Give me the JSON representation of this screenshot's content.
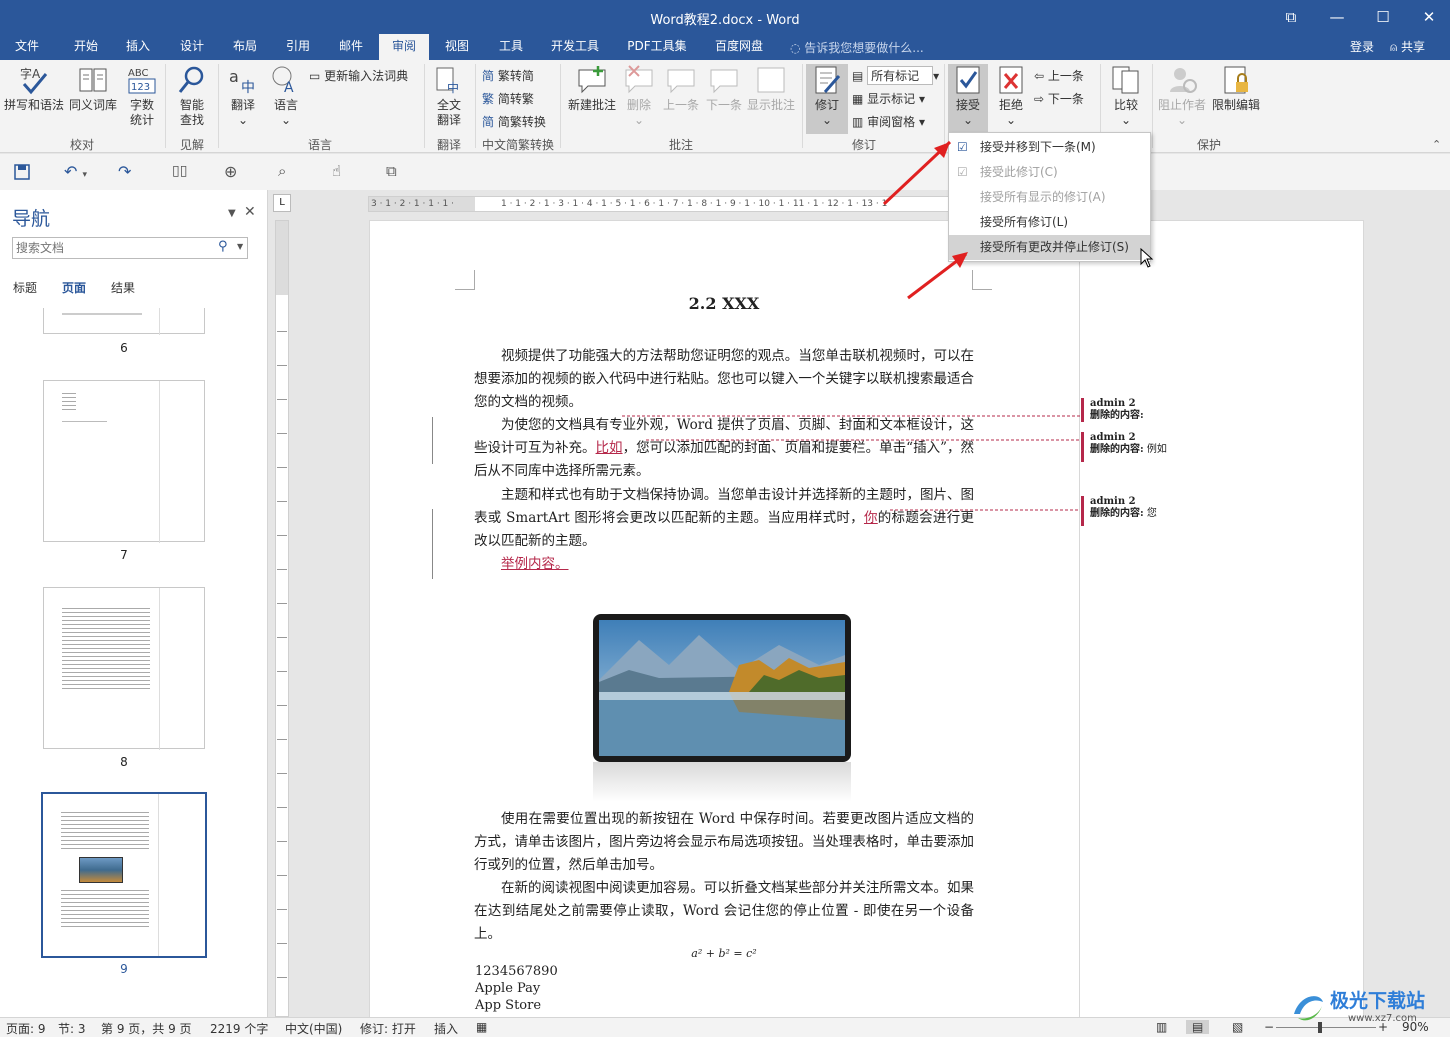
{
  "window": {
    "title": "Word教程2.docx - Word",
    "restore": "⧉",
    "minimize": "—",
    "maximize": "☐",
    "close": "✕"
  },
  "tabs": [
    {
      "label": "文件"
    },
    {
      "label": "开始"
    },
    {
      "label": "插入"
    },
    {
      "label": "设计"
    },
    {
      "label": "布局"
    },
    {
      "label": "引用"
    },
    {
      "label": "邮件"
    },
    {
      "label": "审阅"
    },
    {
      "label": "视图"
    },
    {
      "label": "工具"
    },
    {
      "label": "开发工具"
    },
    {
      "label": "PDF工具集"
    },
    {
      "label": "百度网盘"
    }
  ],
  "tellme": "告诉我您想要做什么...",
  "account": {
    "login": "登录",
    "share": "共享"
  },
  "ribbon": {
    "spell": "拼写和语法",
    "thesaurus": "同义词库",
    "wordcount1": "字数",
    "wordcount2": "统计",
    "smart1": "智能",
    "smart2": "查找",
    "translate": "翻译",
    "language": "语言",
    "ime_dict": "更新输入法词典",
    "fulltrans1": "全文",
    "fulltrans2": "翻译",
    "t2s": "繁转简",
    "s2t": "简转繁",
    "convert": "简繁转换",
    "new_comment": "新建批注",
    "delete": "删除",
    "prev": "上一条",
    "next": "下一条",
    "show_comments": "显示批注",
    "track": "修订",
    "all_markup": "所有标记",
    "show_markup": "显示标记",
    "review_pane": "审阅窗格",
    "accept": "接受",
    "reject": "拒绝",
    "prev_change": "上一条",
    "next_change": "下一条",
    "compare": "比较",
    "block_authors": "阻止作者",
    "restrict": "限制编辑",
    "groups": {
      "proofing": "校对",
      "insights": "见解",
      "language": "语言",
      "translation": "翻译",
      "chinese": "中文简繁转换",
      "comments": "批注",
      "tracking": "修订",
      "protect": "保护"
    }
  },
  "menu": [
    {
      "label": "接受并移到下一条(M)",
      "enabled": true
    },
    {
      "label": "接受此修订(C)",
      "enabled": false
    },
    {
      "label": "接受所有显示的修订(A)",
      "enabled": false
    },
    {
      "label": "接受所有修订(L)",
      "enabled": true
    },
    {
      "label": "接受所有更改并停止修订(S)",
      "enabled": true,
      "highlighted": true
    }
  ],
  "nav": {
    "title": "导航",
    "search_placeholder": "搜索文档",
    "tabs": [
      "标题",
      "页面",
      "结果"
    ],
    "active_tab": "页面",
    "pages": [
      "6",
      "7",
      "8",
      "9"
    ],
    "current_page": "9"
  },
  "document": {
    "heading": "2.2 XXX",
    "para1": "视频提供了功能强大的方法帮助您证明您的观点。当您单击联机视频时，可以在想要添加的视频的嵌入代码中进行粘贴。您也可以键入一个关键字以联机搜索最适合您的文档的视频。",
    "para2a": "为使您的文档具有专业外观，Word 提供了页眉、页脚、封面和文本框设计，这些设计可互为补充。",
    "para2_ins": "比如",
    "para2b": "，您可以添加匹配的封面、页眉和提要栏。单击“插入”，然后从不同库中选择所需元素。",
    "para3a": "主题和样式也有助于文档保持协调。当您单击设计并选择新的主题时，图片、图表或 SmartArt 图形将会更改以匹配新的主题。当应用样式时，",
    "para3_ins": "你",
    "para3b": "的标题会进行更改以匹配新的主题。",
    "para4_ins": "举例内容。",
    "para5": "使用在需要位置出现的新按钮在 Word 中保存时间。若要更改图片适应文档的方式，请单击该图片，图片旁边将会显示布局选项按钮。当处理表格时，单击要添加行或列的位置，然后单击加号。",
    "para6": "在新的阅读视图中阅读更加容易。可以折叠文档某些部分并关注所需文本。如果在达到结尾处之前需要停止读取，Word 会记住您的停止位置 - 即使在另一个设备上。",
    "formula": "a² + b² = c²",
    "lines": [
      "1234567890",
      "Apple Pay",
      "App Store"
    ]
  },
  "balloons": [
    {
      "author": "admin 2",
      "label": "删除的内容:",
      "text": ""
    },
    {
      "author": "admin 2",
      "label": "删除的内容:",
      "text": "例如"
    },
    {
      "author": "admin 2",
      "label": "删除的内容:",
      "text": "您"
    }
  ],
  "status": {
    "page": "页面: 9",
    "section": "节: 3",
    "pages": "第 9 页，共 9 页",
    "words": "2219 个字",
    "lang": "中文(中国)",
    "track": "修订: 打开",
    "insert": "插入",
    "zoom": "90%"
  },
  "watermark": "极光下载站",
  "watermark_url": "www.xz7.com",
  "colors": {
    "brand": "#2b579a",
    "insert": "#b5284a",
    "arrow": "#e02020"
  }
}
